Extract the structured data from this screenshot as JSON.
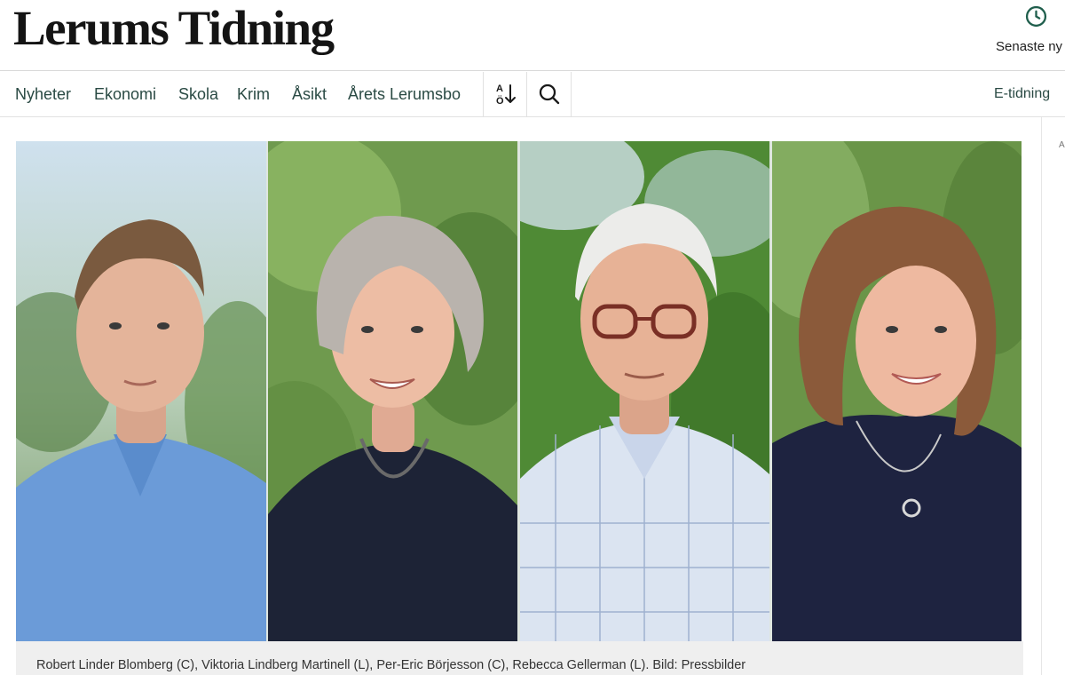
{
  "header": {
    "logo_text": "Lerums Tidning",
    "latest_label": "Senaste ny",
    "latest_icon": "clock-icon"
  },
  "nav": {
    "items": [
      {
        "label": "Nyheter"
      },
      {
        "label": "Ekonomi"
      },
      {
        "label": "Skola"
      },
      {
        "label": "Krim"
      },
      {
        "label": "Åsikt"
      },
      {
        "label": "Årets Lerumsbo"
      }
    ],
    "sort_icon": "sort-alpha-icon",
    "sort_glyph_top": "A",
    "sort_glyph_bottom": "Ö",
    "search_icon": "search-icon",
    "etidning_label": "E-tidning"
  },
  "rail": {
    "mark": "A"
  },
  "article": {
    "caption": "Robert Linder Blomberg (C), Viktoria Lindberg Martinell (L), Per-Eric Börjesson (C), Rebecca Gellerman (L). Bild: Pressbilder"
  },
  "colors": {
    "nav_text": "#2a4a44",
    "accent_green": "#1f5e4c"
  }
}
